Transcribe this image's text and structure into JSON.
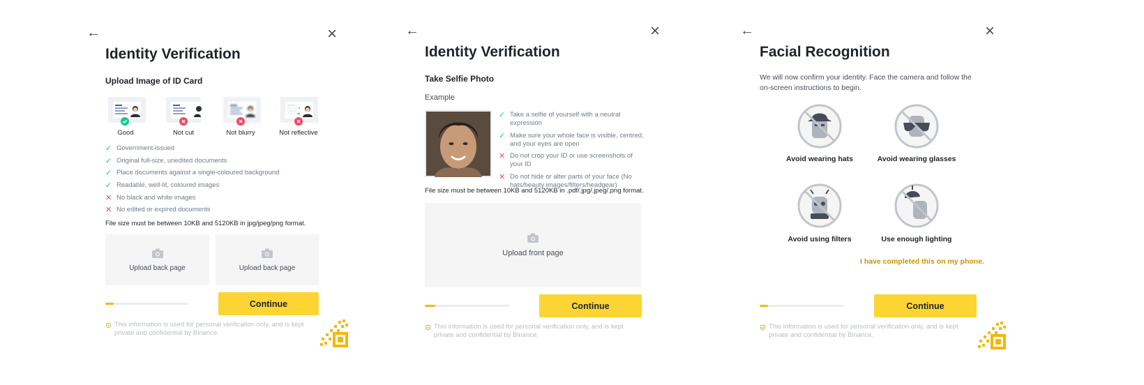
{
  "panel1": {
    "title": "Identity Verification",
    "subtitle": "Upload Image of ID Card",
    "examples": [
      {
        "label": "Good",
        "status": "ok"
      },
      {
        "label": "Not cut",
        "status": "bad"
      },
      {
        "label": "Not blurry",
        "status": "bad"
      },
      {
        "label": "Not reflective",
        "status": "bad"
      }
    ],
    "requirements": [
      {
        "text": "Government-issued",
        "ok": true
      },
      {
        "text": "Original full-size, unedited documents",
        "ok": true
      },
      {
        "text": "Place documents against a single-coloured background",
        "ok": true
      },
      {
        "text": "Readable, well-lit, coloured images",
        "ok": true
      },
      {
        "text": "No black and white images",
        "ok": false
      },
      {
        "text": "No edited or expired documents",
        "ok": false
      }
    ],
    "filesize": "File size must be between 10KB and 5120KB in jpg/jpeg/png format.",
    "upload_left": "Upload back page",
    "upload_right": "Upload back page",
    "progress": 0.1,
    "continue": "Continue",
    "privacy": "This information is used for personal verification only, and is kept private and confidential by Binance."
  },
  "panel2": {
    "title": "Identity Verification",
    "subtitle": "Take Selfie Photo",
    "example_label": "Example",
    "tips": [
      {
        "text": "Take a selfie of yourself with a neutral expression",
        "ok": true
      },
      {
        "text": "Make sure your whole face is visible, centred, and your eyes are open",
        "ok": true
      },
      {
        "text": "Do not crop your ID or use screenshots of your ID",
        "ok": false
      },
      {
        "text": "Do not hide or alter parts of your face (No hats/beauty images/filters/headgear)",
        "ok": false
      }
    ],
    "filesize": "File size must be between 10KB and 5120KB in .pdf/.jpg/.jpeg/.png format.",
    "upload": "Upload front page",
    "progress": 0.12,
    "continue": "Continue",
    "privacy": "This information is used for personal verification only, and is kept private and confidential by Binance."
  },
  "panel3": {
    "title": "Facial Recognition",
    "description": "We will now confirm your identity. Face the camera and follow the on-screen instructions to begin.",
    "items": [
      {
        "label": "Avoid wearing hats",
        "icon": "no-hat-icon"
      },
      {
        "label": "Avoid wearing glasses",
        "icon": "no-glasses-icon"
      },
      {
        "label": "Avoid using filters",
        "icon": "no-filters-icon"
      },
      {
        "label": "Use enough lighting",
        "icon": "lighting-icon"
      }
    ],
    "phone_link": "I have completed this on my phone.",
    "progress": 0.1,
    "continue": "Continue",
    "privacy": "This information is used for personal verification only, and is kept private and confidential by Binance."
  },
  "colors": {
    "accent": "#fcd535",
    "progress": "#f0b90b",
    "ok": "#0ecb81",
    "bad": "#f6465d",
    "link": "#c99400"
  },
  "glyphs": {
    "back": "←",
    "close": "×",
    "check": "✓",
    "cross": "✕"
  }
}
